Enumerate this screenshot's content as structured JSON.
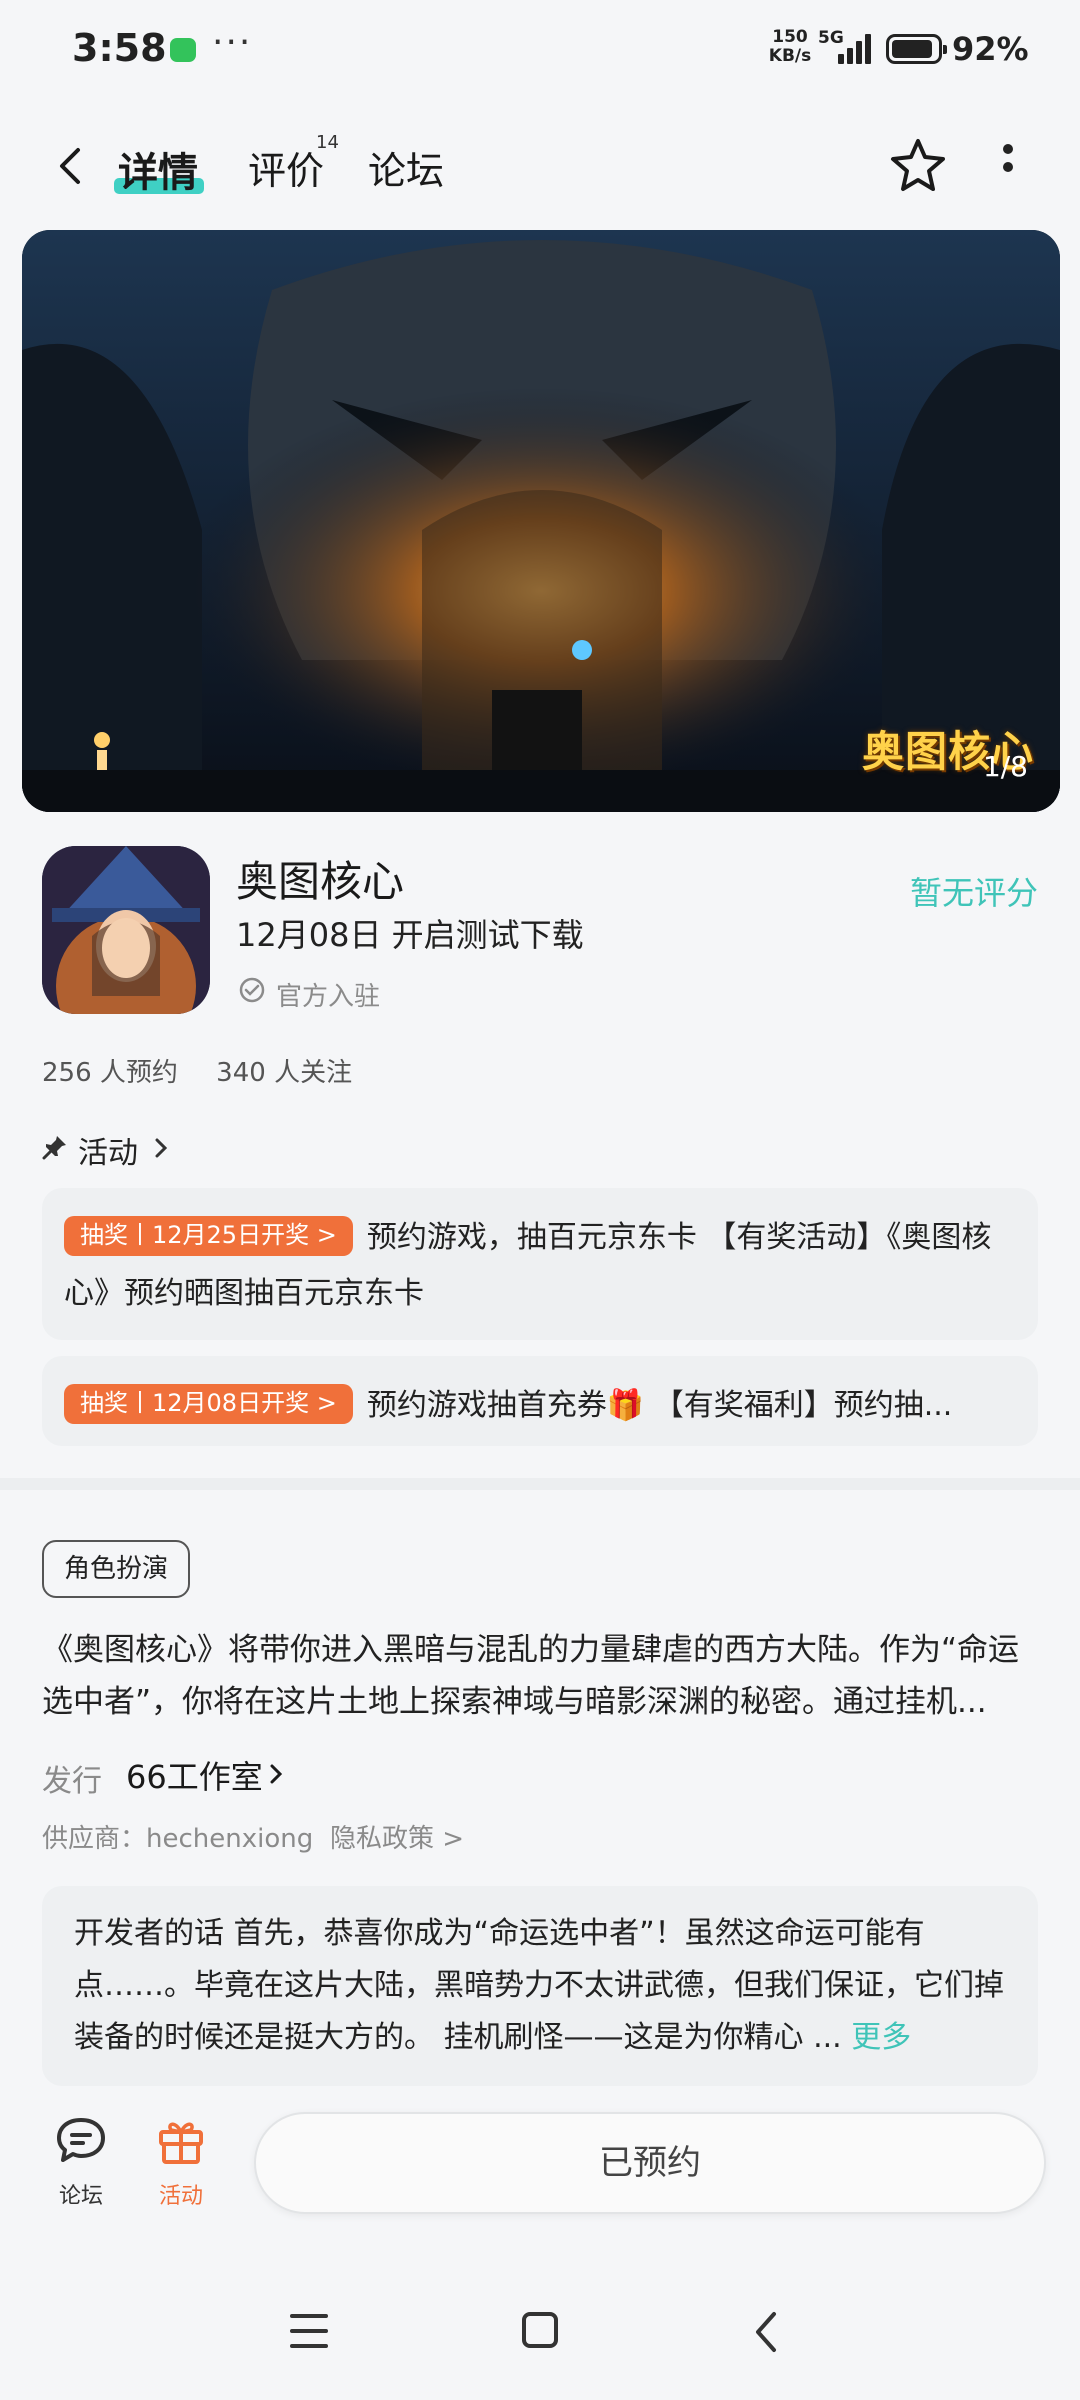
{
  "status_bar": {
    "time": "3:58",
    "dots": "···",
    "net_speed_value": "150",
    "net_speed_unit": "KB/s",
    "net_type": "5G",
    "battery": "92%",
    "battery_level": 0.92
  },
  "nav": {
    "tabs": [
      {
        "label": "详情"
      },
      {
        "label": "评价"
      },
      {
        "label": "论坛"
      }
    ],
    "review_count": "14"
  },
  "banner": {
    "logo_text": "奥图核心",
    "counter": "1/8"
  },
  "app": {
    "name": "奥图核心",
    "release": "12月08日 开启测试下载",
    "official": "官方入驻",
    "rating": "暂无评分"
  },
  "stats": {
    "reservations": "256 人预约",
    "followers": "340 人关注"
  },
  "activity": {
    "title": "活动",
    "items": [
      {
        "tag": "抽奖丨12月25日开奖",
        "text": "预约游戏，抽百元京东卡 【有奖活动】《奥图核心》预约晒图抽百元京东卡"
      },
      {
        "tag": "抽奖丨12月08日开奖",
        "text": "预约游戏抽首充券🎁 【有奖福利】预约抽..."
      }
    ]
  },
  "genre": "角色扮演",
  "description": "《奥图核心》将带你进入黑暗与混乱的力量肆虐的西方大陆。作为“命运选中者”，你将在这片土地上探索神域与暗影深渊的秘密。通过挂机...",
  "publisher": {
    "label": "发行",
    "name": "66工作室"
  },
  "supplier": "供应商：hechenxiong",
  "privacy": "隐私政策 >",
  "developer_note": {
    "text": "开发者的话  首先，恭喜你成为“命运选中者”！虽然这命运可能有点……。毕竟在这片大陆，黑暗势力不太讲武德，但我们保证，它们掉装备的时候还是挺大方的。 挂机刷怪——这是为你精心 ...",
    "more": "更多"
  },
  "bottom_bar": {
    "forum": "论坛",
    "activity": "活动",
    "reserved": "已预约"
  },
  "colors": {
    "accent": "#3fd0c4",
    "rating": "#3fc4b8",
    "orange": "#f0703a"
  }
}
